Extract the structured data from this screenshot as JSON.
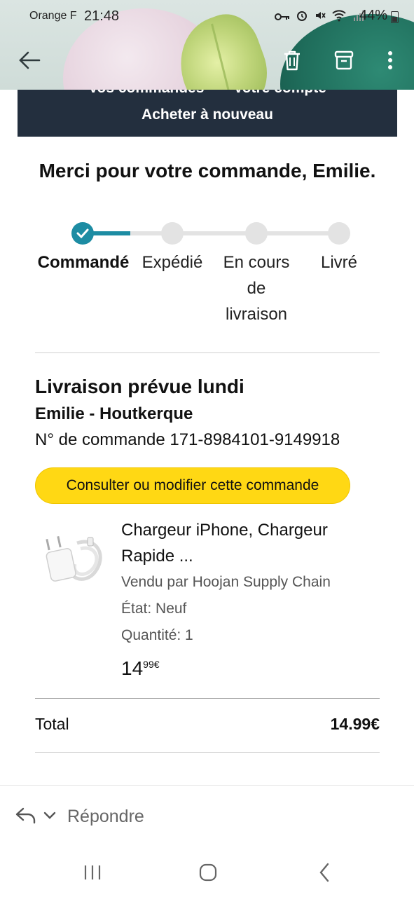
{
  "status_bar": {
    "carrier": "Orange F",
    "time": "21:48",
    "battery": "44%"
  },
  "header": {
    "partial_links": [
      "Vos commandes",
      "Votre compte"
    ],
    "buy_again": "Acheter à nouveau"
  },
  "thanks_message": "Merci pour votre commande, Emilie.",
  "progress": {
    "steps": [
      "Commandé",
      "Expédié",
      "En cours de livraison",
      "Livré"
    ],
    "current_step": 1,
    "accent_color": "#1d8ca3"
  },
  "delivery": {
    "title": "Livraison prévue lundi",
    "recipient": "Emilie - Houtkerque",
    "order_number": "N° de commande 171-8984101-9149918"
  },
  "action_button": {
    "label": "Consulter ou modifier cette commande",
    "color": "#ffd814"
  },
  "product": {
    "title": "Chargeur iPhone, Chargeur Rapide ...",
    "seller": "Vendu par Hoojan Supply Chain",
    "condition": "État: Neuf",
    "quantity": "Quantité: 1",
    "price_main": "14",
    "price_cents": "99€"
  },
  "total": {
    "label": "Total",
    "value": "14.99€"
  },
  "reply": {
    "label": "Répondre"
  },
  "icons": [
    "back-arrow-icon",
    "delete-icon",
    "archive-icon",
    "more-vert-icon",
    "key-icon",
    "alarm-icon",
    "mute-icon",
    "wifi-icon",
    "signal-icon",
    "battery-icon",
    "check-icon",
    "reply-icon",
    "chevron-down-icon",
    "recents-icon",
    "home-icon",
    "nav-back-icon"
  ]
}
